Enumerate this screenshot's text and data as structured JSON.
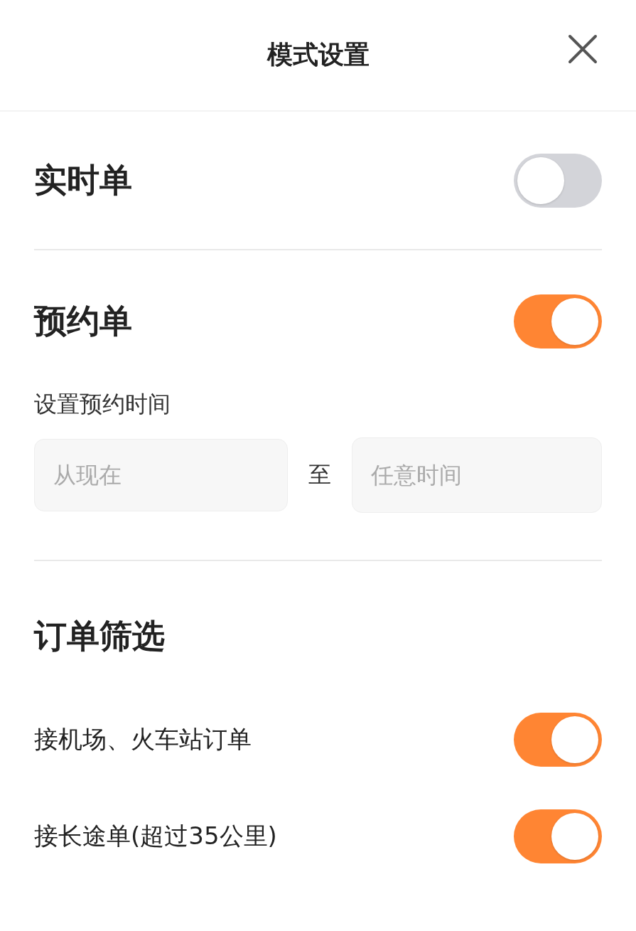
{
  "header": {
    "title": "模式设置"
  },
  "realtime": {
    "label": "实时单",
    "on": false
  },
  "reservation": {
    "label": "预约单",
    "on": true,
    "time_label": "设置预约时间",
    "from": {
      "placeholder": "从现在"
    },
    "separator": "至",
    "to": {
      "placeholder": "任意时间"
    }
  },
  "filter": {
    "title": "订单筛选",
    "items": [
      {
        "label": "接机场、火车站订单",
        "on": true
      },
      {
        "label": "接长途单(超过35公里)",
        "on": true
      }
    ]
  }
}
